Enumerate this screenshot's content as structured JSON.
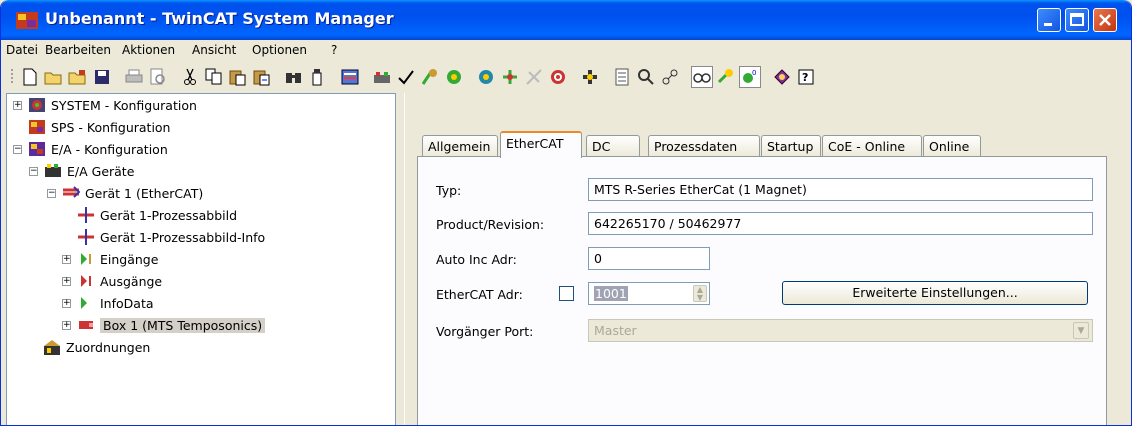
{
  "window": {
    "title": "Unbenannt - TwinCAT System Manager"
  },
  "menu": [
    "Datei",
    "Bearbeiten",
    "Aktionen",
    "Ansicht",
    "Optionen",
    "?"
  ],
  "toolbar_icons": [
    "new-icon",
    "open-icon",
    "open-project-icon",
    "save-icon",
    "print-icon",
    "print-preview-icon",
    "cut-icon",
    "copy-icon",
    "paste-icon",
    "paste-with-links-icon",
    "find-icon",
    "find-next-icon",
    "generate-mappings-icon",
    "check-configuration-icon",
    "activate-configuration-icon",
    "set-run-mode-icon",
    "restart-config-mode-icon",
    "reload-devices-icon",
    "scan-devices-icon",
    "toggle-free-run-icon",
    "show-online-data-icon",
    "choose-target-icon",
    "show-sub-items-icon",
    "zoom-icon",
    "network-icon",
    "goggles-icon",
    "lamp-icon",
    "counter-icon",
    "help-book-icon",
    "help-icon"
  ],
  "tree": [
    {
      "label": "SYSTEM - Konfiguration",
      "icon": "system-config-icon"
    },
    {
      "label": "SPS - Konfiguration",
      "icon": "plc-config-icon"
    },
    {
      "label": "E/A - Konfiguration",
      "icon": "io-config-icon"
    },
    {
      "label": "E/A Geräte",
      "icon": "io-devices-icon"
    },
    {
      "label": "Gerät 1 (EtherCAT)",
      "icon": "ethercat-device-icon"
    },
    {
      "label": "Gerät 1-Prozessabbild",
      "icon": "process-image-icon"
    },
    {
      "label": "Gerät 1-Prozessabbild-Info",
      "icon": "process-image-info-icon"
    },
    {
      "label": "Eingänge",
      "icon": "inputs-icon"
    },
    {
      "label": "Ausgänge",
      "icon": "outputs-icon"
    },
    {
      "label": "InfoData",
      "icon": "infodata-icon"
    },
    {
      "label": "Box 1 (MTS Temposonics)",
      "icon": "box-icon"
    },
    {
      "label": "Zuordnungen",
      "icon": "mappings-icon"
    }
  ],
  "tabs": [
    "Allgemein",
    "EtherCAT",
    "DC",
    "Prozessdaten",
    "Startup",
    "CoE - Online",
    "Online"
  ],
  "form": {
    "typ_label": "Typ:",
    "typ_value": "MTS R-Series EtherCat (1 Magnet)",
    "product_label": "Product/Revision:",
    "product_value": "642265170 / 50462977",
    "autoinc_label": "Auto Inc Adr:",
    "autoinc_value": "0",
    "ethercat_label": "EtherCAT Adr:",
    "ethercat_value": "1001",
    "advanced_button": "Erweiterte Einstellungen...",
    "port_label": "Vorgänger Port:",
    "port_value": "Master"
  }
}
